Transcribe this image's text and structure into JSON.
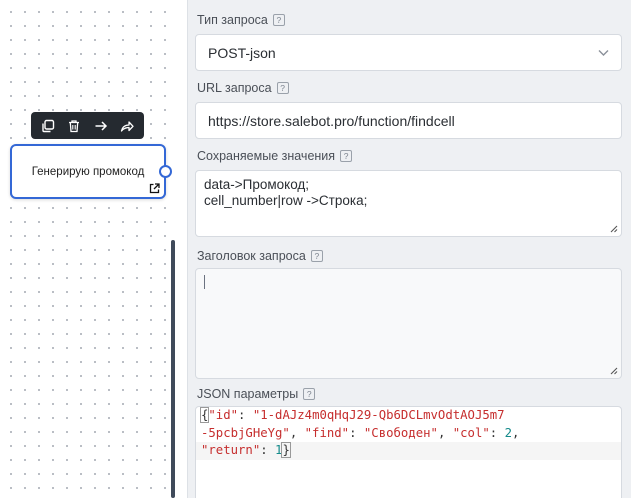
{
  "canvas": {
    "node": {
      "title": "Генерирую промокод"
    },
    "toolbar": {
      "icons": [
        "copy-icon",
        "trash-icon",
        "arrow-right-icon",
        "share-icon"
      ]
    }
  },
  "panel": {
    "request_type": {
      "label": "Тип запроса",
      "help": "?",
      "value": "POST-json"
    },
    "url": {
      "label": "URL запроса",
      "help": "?",
      "value": "https://store.salebot.pro/function/findcell"
    },
    "saved_values": {
      "label": "Сохраняемые значения",
      "help": "?",
      "lines": [
        "data->Промокод;",
        "cell_number|row ->Строка;"
      ]
    },
    "request_header": {
      "label": "Заголовок запроса",
      "help": "?",
      "value": ""
    },
    "json_params": {
      "label": "JSON параметры",
      "help": "?",
      "tokens": {
        "open_brace": "{",
        "key_id": "\"id\"",
        "colon1": ": ",
        "id_value_part1": "\"1-dAJz4m0qHqJ29-Qb6DCLmvOdtAOJ5m7",
        "id_value_part2": "-5pcbjGHeYg\"",
        "comma1": ", ",
        "key_find": "\"find\"",
        "colon2": ": ",
        "find_value": "\"Свободен\"",
        "comma2": ", ",
        "key_col": "\"col\"",
        "colon3": ": ",
        "col_value": "2",
        "comma3": ",",
        "key_return": "\"return\"",
        "colon4": ": ",
        "return_value": "1",
        "close_brace": "}"
      }
    }
  },
  "colors": {
    "node_border": "#3468d6",
    "toolbar_bg": "#252a30",
    "json_string": "#c62e2e",
    "json_number": "#148a8a"
  }
}
